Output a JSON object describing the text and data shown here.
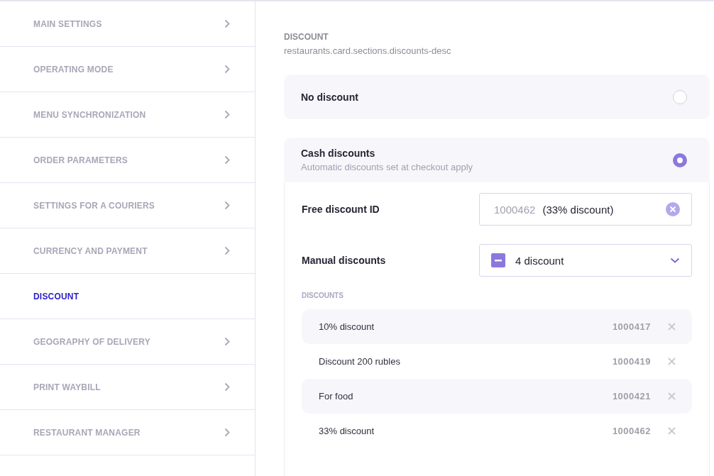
{
  "sidebar": {
    "items": [
      {
        "label": "MAIN SETTINGS",
        "selected": false
      },
      {
        "label": "OPERATING MODE",
        "selected": false
      },
      {
        "label": "MENU SYNCHRONIZATION",
        "selected": false
      },
      {
        "label": "ORDER PARAMETERS",
        "selected": false
      },
      {
        "label": "SETTINGS FOR A COURIERS",
        "selected": false
      },
      {
        "label": "CURRENCY AND PAYMENT",
        "selected": false
      },
      {
        "label": "DISCOUNT",
        "selected": true
      },
      {
        "label": "GEOGRAPHY OF DELIVERY",
        "selected": false
      },
      {
        "label": "PRINT WAYBILL",
        "selected": false
      },
      {
        "label": "RESTAURANT MANAGER",
        "selected": false
      }
    ]
  },
  "section": {
    "title": "DISCOUNT",
    "description": "restaurants.card.sections.discounts-desc"
  },
  "options": [
    {
      "title": "No discount",
      "selected": false
    },
    {
      "title": "Cash discounts",
      "subtitle": "Automatic discounts set at checkout apply",
      "selected": true
    }
  ],
  "free_discount": {
    "label": "Free discount ID",
    "id": "1000462",
    "name": "(33% discount)"
  },
  "manual_discounts": {
    "label": "Manual discounts",
    "value": "4 discount"
  },
  "discounts": {
    "heading": "DISCOUNTS",
    "rows": [
      {
        "name": "10% discount",
        "id": "1000417"
      },
      {
        "name": "Discount 200 rubles",
        "id": "1000419"
      },
      {
        "name": "For food",
        "id": "1000421"
      },
      {
        "name": "33% discount",
        "id": "1000462"
      }
    ]
  }
}
